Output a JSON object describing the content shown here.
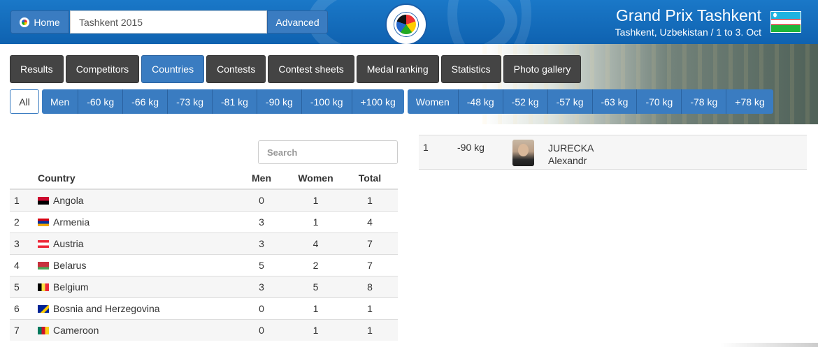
{
  "header": {
    "home_label": "Home",
    "search_value": "Tashkent 2015",
    "advanced_label": "Advanced",
    "logo_icon": "ijf-logo-icon",
    "event_title": "Grand Prix Tashkent",
    "event_subtitle": "Tashkent, Uzbekistan / 1 to 3. Oct",
    "flag": "uzbekistan-flag"
  },
  "nav": {
    "tabs": [
      {
        "label": "Results"
      },
      {
        "label": "Competitors"
      },
      {
        "label": "Countries",
        "active": true
      },
      {
        "label": "Contests"
      },
      {
        "label": "Contest sheets"
      },
      {
        "label": "Medal ranking"
      },
      {
        "label": "Statistics"
      },
      {
        "label": "Photo gallery"
      }
    ]
  },
  "filters": {
    "all_label": "All",
    "men": [
      "Men",
      "-60 kg",
      "-66 kg",
      "-73 kg",
      "-81 kg",
      "-90 kg",
      "-100 kg",
      "+100 kg"
    ],
    "women": [
      "Women",
      "-48 kg",
      "-52 kg",
      "-57 kg",
      "-63 kg",
      "-70 kg",
      "-78 kg",
      "+78 kg"
    ]
  },
  "table": {
    "search_placeholder": "Search",
    "headers": {
      "country": "Country",
      "men": "Men",
      "women": "Women",
      "total": "Total"
    },
    "rows": [
      {
        "rank": "1",
        "country": "Angola",
        "men": "0",
        "women": "1",
        "total": "1",
        "flag": [
          "#cc092f",
          "#000000"
        ]
      },
      {
        "rank": "2",
        "country": "Armenia",
        "men": "3",
        "women": "1",
        "total": "4",
        "flag": [
          "#d90012",
          "#0033a0",
          "#f2a800"
        ]
      },
      {
        "rank": "3",
        "country": "Austria",
        "men": "3",
        "women": "4",
        "total": "7",
        "flag": [
          "#ed2939",
          "#ffffff",
          "#ed2939"
        ]
      },
      {
        "rank": "4",
        "country": "Belarus",
        "men": "5",
        "women": "2",
        "total": "7",
        "flag": [
          "#c8313e",
          "#c8313e",
          "#4aa657"
        ]
      },
      {
        "rank": "5",
        "country": "Belgium",
        "men": "3",
        "women": "5",
        "total": "8",
        "flag": [
          "#000000",
          "#fae042",
          "#ed2939"
        ]
      },
      {
        "rank": "6",
        "country": "Bosnia and Herzegovina",
        "men": "0",
        "women": "1",
        "total": "1",
        "flag": [
          "#002395",
          "#fecb00"
        ]
      },
      {
        "rank": "7",
        "country": "Cameroon",
        "men": "0",
        "women": "1",
        "total": "1",
        "flag": [
          "#007a5e",
          "#ce1126",
          "#fcd116"
        ]
      }
    ]
  },
  "result": {
    "rank": "1",
    "category": "-90 kg",
    "last_name": "JURECKA",
    "first_name": "Alexandr"
  }
}
